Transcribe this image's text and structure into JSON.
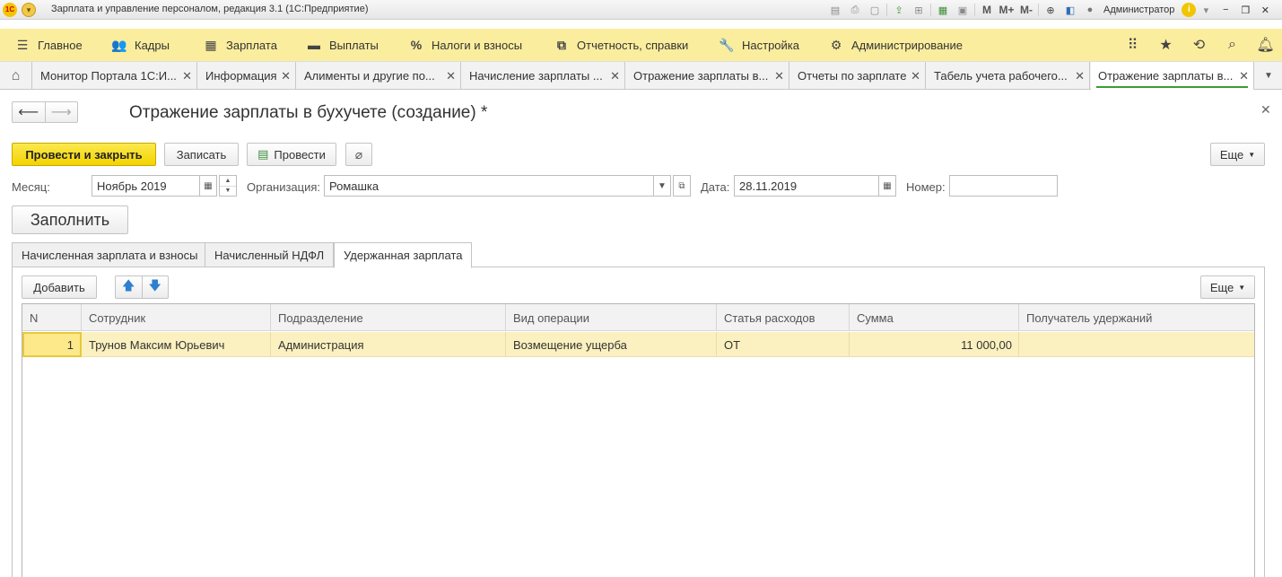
{
  "window": {
    "title": "Зарплата и управление персоналом, редакция 3.1  (1С:Предприятие)",
    "logo_text": "1С",
    "user": "Администратор",
    "toolbar_m": [
      "M",
      "M+",
      "M-"
    ]
  },
  "sections": [
    {
      "label": "Главное",
      "icon": "menu-icon"
    },
    {
      "label": "Кадры",
      "icon": "people-icon"
    },
    {
      "label": "Зарплата",
      "icon": "calculator-icon"
    },
    {
      "label": "Выплаты",
      "icon": "wallet-icon"
    },
    {
      "label": "Налоги и взносы",
      "icon": "percent-icon"
    },
    {
      "label": "Отчетность, справки",
      "icon": "reports-icon"
    },
    {
      "label": "Настройка",
      "icon": "wrench-icon"
    },
    {
      "label": "Администрирование",
      "icon": "gear-icon"
    }
  ],
  "open_tabs": [
    {
      "label": "Монитор Портала 1С:И..."
    },
    {
      "label": "Информация"
    },
    {
      "label": "Алименты и другие по..."
    },
    {
      "label": "Начисление зарплаты ..."
    },
    {
      "label": "Отражение зарплаты в..."
    },
    {
      "label": "Отчеты по зарплате"
    },
    {
      "label": "Табель учета рабочего..."
    },
    {
      "label": "Отражение зарплаты в..."
    }
  ],
  "form": {
    "title": "Отражение зарплаты в бухучете (создание) *",
    "buttons": {
      "post_close": "Провести и закрыть",
      "save": "Записать",
      "post": "Провести",
      "more": "Еще",
      "fill": "Заполнить"
    },
    "fields": {
      "month_label": "Месяц:",
      "month_value": "Ноябрь 2019",
      "org_label": "Организация:",
      "org_value": "Ромашка",
      "date_label": "Дата:",
      "date_value": "28.11.2019",
      "number_label": "Номер:",
      "number_value": ""
    },
    "tabs": [
      "Начисленная зарплата и взносы",
      "Начисленный НДФЛ",
      "Удержанная зарплата"
    ],
    "active_tab": "Удержанная зарплата",
    "table_toolbar": {
      "add": "Добавить",
      "more": "Еще"
    },
    "table": {
      "columns": [
        "N",
        "Сотрудник",
        "Подразделение",
        "Вид операции",
        "Статья расходов",
        "Сумма",
        "Получатель удержаний"
      ],
      "rows": [
        {
          "n": "1",
          "employee": "Трунов Максим Юрьевич",
          "department": "Администрация",
          "operation": "Возмещение ущерба",
          "expense": "ОТ",
          "amount": "11 000,00",
          "recipient": ""
        }
      ]
    }
  },
  "colors": {
    "sections_bg": "#fbed9e",
    "primary_button": "#f4d300",
    "selected_row": "#fbf0bf",
    "active_tab_underline": "#3f9c35"
  }
}
